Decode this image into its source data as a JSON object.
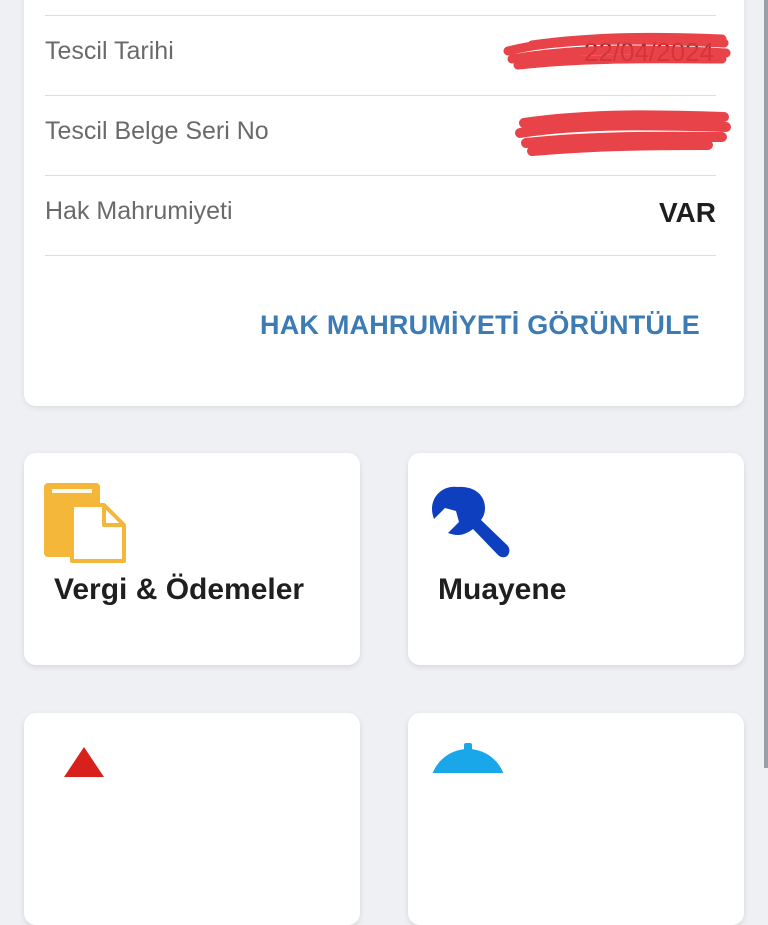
{
  "vehicle_info": {
    "rows": [
      {
        "label": "Tescil Tarihi",
        "value": "22/04/2024",
        "redacted": true
      },
      {
        "label": "Tescil Belge Seri No",
        "value": "",
        "redacted": true
      },
      {
        "label": "Hak Mahrumiyeti",
        "value": "VAR",
        "redacted": false
      }
    ],
    "action_label": "HAK MAHRUMİYETİ GÖRÜNTÜLE"
  },
  "tiles": [
    {
      "label": "Vergi & Ödemeler",
      "icon": "documents-icon",
      "color": "#f4b73a"
    },
    {
      "label": "Muayene",
      "icon": "wrench-icon",
      "color": "#0d3fbf"
    },
    {
      "label": "",
      "icon": "warning-triangle-icon",
      "color": "#d8201c"
    },
    {
      "label": "",
      "icon": "stopwatch-icon",
      "color": "#1aa7ea"
    }
  ],
  "colors": {
    "background": "#eef0f3",
    "card": "#ffffff",
    "link": "#3d7bb5",
    "redaction": "#e5333a"
  }
}
